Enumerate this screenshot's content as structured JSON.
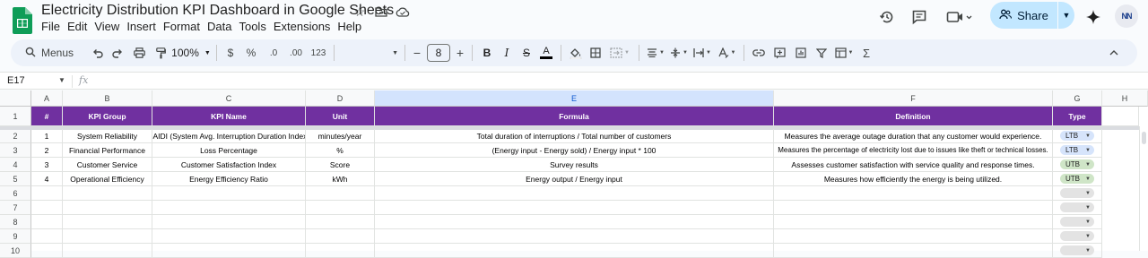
{
  "app": {
    "doc_title": "Electricity Distribution KPI Dashboard in Google Sheets",
    "menu": [
      "File",
      "Edit",
      "View",
      "Insert",
      "Format",
      "Data",
      "Tools",
      "Extensions",
      "Help"
    ],
    "share_label": "Share",
    "avatar_text": "NN",
    "brand_color": "#0f9d58",
    "share_bg": "#c2e7ff"
  },
  "toolbar": {
    "menus_label": "Menus",
    "zoom": "100%",
    "currency": "$",
    "percent": "%",
    "dec_decrease": ".0",
    "dec_increase": ".00",
    "number_format": "123",
    "font_size": "8",
    "minus": "−",
    "plus": "+",
    "sum": "Σ"
  },
  "formula_bar": {
    "name_box": "E17",
    "fx": "fx",
    "content": ""
  },
  "columns": [
    "A",
    "B",
    "C",
    "D",
    "E",
    "F",
    "G",
    "H"
  ],
  "selected_column": "E",
  "row_numbers": [
    "1",
    "2",
    "3",
    "4",
    "5",
    "6",
    "7",
    "8",
    "9",
    "10"
  ],
  "table": {
    "header_color": "#7030a0",
    "headers": [
      "#",
      "KPI Group",
      "KPI Name",
      "Unit",
      "Formula",
      "Definition",
      "Type"
    ],
    "rows": [
      {
        "num": "1",
        "group": "System Reliability",
        "name": "SAIDI (System Avg. Interruption Duration Index)",
        "unit": "minutes/year",
        "formula": "Total duration of interruptions / Total number of customers",
        "definition": "Measures the average outage duration that any customer would experience.",
        "type": "LTB"
      },
      {
        "num": "2",
        "group": "Financial Performance",
        "name": "Loss Percentage",
        "unit": "%",
        "formula": "(Energy input - Energy sold) / Energy input * 100",
        "definition": "Measures the percentage of electricity lost due to issues like theft or technical losses.",
        "type": "LTB"
      },
      {
        "num": "3",
        "group": "Customer Service",
        "name": "Customer Satisfaction Index",
        "unit": "Score",
        "formula": "Survey results",
        "definition": "Assesses customer satisfaction with service quality and response times.",
        "type": "UTB"
      },
      {
        "num": "4",
        "group": "Operational Efficiency",
        "name": "Energy Efficiency Ratio",
        "unit": "kWh",
        "formula": "Energy output / Energy input",
        "definition": "Measures how efficiently the energy is being utilized.",
        "type": "UTB"
      }
    ]
  },
  "chip_colors": {
    "LTB": "#d6e4fb",
    "UTB": "#cfe5c7",
    "empty": "#e3e3e3"
  },
  "icons": [
    "sheets-logo-icon",
    "star-icon",
    "move-folder-icon",
    "cloud-saved-icon",
    "history-icon",
    "comment-icon",
    "meet-icon",
    "people-icon",
    "gemini-icon",
    "search-icon",
    "undo-icon",
    "redo-icon",
    "print-icon",
    "paint-format-icon"
  ]
}
